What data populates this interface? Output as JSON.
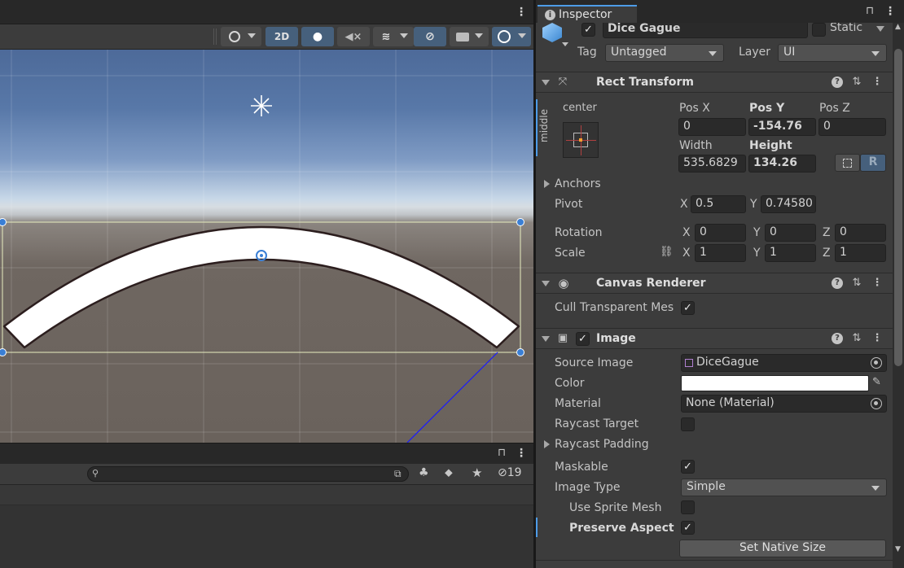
{
  "scene": {
    "toolbar": {
      "mode_2d_label": "2D",
      "icons": [
        "shading-sphere-icon",
        "lighting-icon",
        "audio-mute-icon",
        "effects-icon",
        "hidden-visibility-icon",
        "camera-icon",
        "gizmos-icon"
      ]
    },
    "object_label": "Dice Gague"
  },
  "project": {
    "search": {
      "placeholder": ""
    },
    "hidden_count": "19"
  },
  "inspector": {
    "tab_label": "Inspector",
    "object": {
      "enabled": true,
      "name": "Dice Gague",
      "static_label": "Static",
      "tag_label": "Tag",
      "tag_value": "Untagged",
      "layer_label": "Layer",
      "layer_value": "UI"
    },
    "rect_transform": {
      "title": "Rect Transform",
      "anchor_h": "center",
      "anchor_v": "middle",
      "posx_label": "Pos X",
      "posx": "0",
      "posy_label": "Pos Y",
      "posy": "-154.76",
      "posz_label": "Pos Z",
      "posz": "0",
      "width_label": "Width",
      "width": "535.6829",
      "height_label": "Height",
      "height": "134.26",
      "raw_edit_label": "R",
      "anchors_label": "Anchors",
      "pivot_label": "Pivot",
      "pivot_x": "0.5",
      "pivot_y": "0.74580",
      "rotation_label": "Rotation",
      "rot_x": "0",
      "rot_y": "0",
      "rot_z": "0",
      "scale_label": "Scale",
      "scale_x": "1",
      "scale_y": "1",
      "scale_z": "1",
      "x": "X",
      "y": "Y",
      "z": "Z"
    },
    "canvas_renderer": {
      "title": "Canvas Renderer",
      "cull_label": "Cull Transparent Mes",
      "cull_value": true
    },
    "image": {
      "title": "Image",
      "enabled": true,
      "source_label": "Source Image",
      "source_value": "DiceGague",
      "color_label": "Color",
      "color_value": "#ffffff",
      "material_label": "Material",
      "material_value": "None (Material)",
      "raycast_target_label": "Raycast Target",
      "raycast_target": false,
      "raycast_padding_label": "Raycast Padding",
      "maskable_label": "Maskable",
      "maskable": true,
      "image_type_label": "Image Type",
      "image_type_value": "Simple",
      "use_sprite_mesh_label": "Use Sprite Mesh",
      "use_sprite_mesh": false,
      "preserve_aspect_label": "Preserve Aspect",
      "preserve_aspect": true,
      "native_size_button": "Set Native Size"
    }
  },
  "colors": {
    "accent": "#4d9ce8",
    "panel": "#3c3c3c",
    "field": "#2a2a2a",
    "rect_outline": "#e8eec0",
    "handle": "#3a7fd5"
  }
}
